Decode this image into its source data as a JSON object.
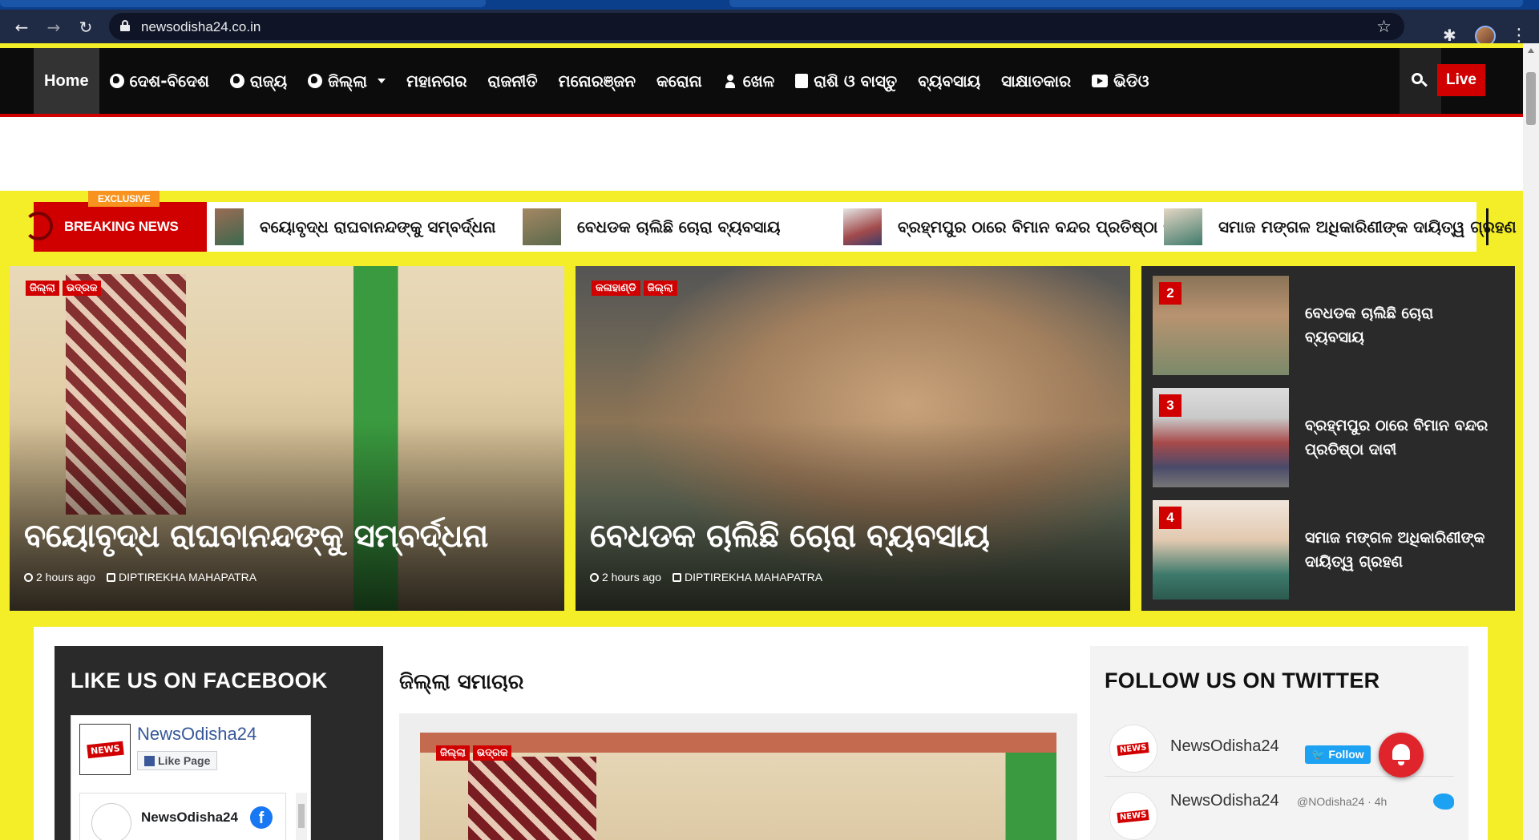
{
  "browser": {
    "url": "newsodisha24.co.in"
  },
  "nav": {
    "home": "Home",
    "items": [
      "ଦେଶ-ବିଦେଶ",
      "ରାଜ୍ୟ",
      "ଜିଲ୍ଲା",
      "ମହାନଗର",
      "ରାଜନୀତି",
      "ମନୋରଞ୍ଜନ",
      "କରୋନା",
      "ଖେଳ",
      "ରାଶି ଓ ବାସ୍ତୁ",
      "ବ୍ୟବସାୟ",
      "ସାକ୍ଷାତକାର",
      "ଭିଡିଓ"
    ],
    "live": "Live"
  },
  "ticker": {
    "exclusive": "EXCLUSIVE",
    "label": "BREAKING NEWS",
    "items": [
      "ବୟୋବୃଦ୍ଧ ରାଘବାନନ୍ଦଙ୍କୁ ସମ୍ବର୍ଦ୍ଧନା",
      "ବେଧଡକ ଚାଲିଛି ଚୋରା ବ୍ୟବସାୟ",
      "ବ୍ରହ୍ମପୁର ଠାରେ ବିମାନ ବନ୍ଦର ପ୍ରତିଷ୍ଠା ଦାବୀ",
      "ସମାଜ ମଙ୍ଗଳ ଅଧିକାରିଣୀଙ୍କ ଦାୟିତ୍ୱ ଗ୍ରହଣ"
    ]
  },
  "hero": [
    {
      "tags": [
        "ଜିଲ୍ଲା",
        "ଭଦ୍ରକ"
      ],
      "title": "ବୟୋବୃଦ୍ଧ ରାଘବାନନ୍ଦଙ୍କୁ ସମ୍ବର୍ଦ୍ଧନା",
      "time": "2 hours ago",
      "author": "DIPTIREKHA MAHAPATRA"
    },
    {
      "tags": [
        "କଳାହାଣ୍ଡି",
        "ଜିଲ୍ଲା"
      ],
      "title": "ବେଧଡକ ଚାଲିଛି ଚୋରା ବ୍ୟବସାୟ",
      "time": "2 hours ago",
      "author": "DIPTIREKHA MAHAPATRA"
    }
  ],
  "trending": [
    {
      "num": "2",
      "title": "ବେଧଡକ ଚାଲିଛି ଚୋରା ବ୍ୟବସାୟ"
    },
    {
      "num": "3",
      "title": "ବ୍ରହ୍ମପୁର ଠାରେ ବିମାନ ବନ୍ଦର ପ୍ରତିଷ୍ଠା ଦାବୀ"
    },
    {
      "num": "4",
      "title": "ସମାଜ ମଙ୍ଗଳ ଅଧିକାରିଣୀଙ୍କ ଦାୟିତ୍ୱ ଗ୍ରହଣ"
    }
  ],
  "facebook": {
    "heading": "LIKE US ON FACEBOOK",
    "page_name": "NewsOdisha24",
    "like_label": "Like Page",
    "post_name": "NewsOdisha24",
    "logo_text": "NEWS"
  },
  "district": {
    "heading": "ଜିଲ୍ଲା ସମାଚାର",
    "tags": [
      "ଜିଲ୍ଲା",
      "ଭଦ୍ରକ"
    ]
  },
  "twitter": {
    "heading": "FOLLOW US ON TWITTER",
    "name": "NewsOdisha24",
    "follow_label": "Follow",
    "tweet_name": "NewsOdisha24",
    "tweet_handle": "@NOdisha24 · 4h",
    "logo_text": "NEWS"
  }
}
